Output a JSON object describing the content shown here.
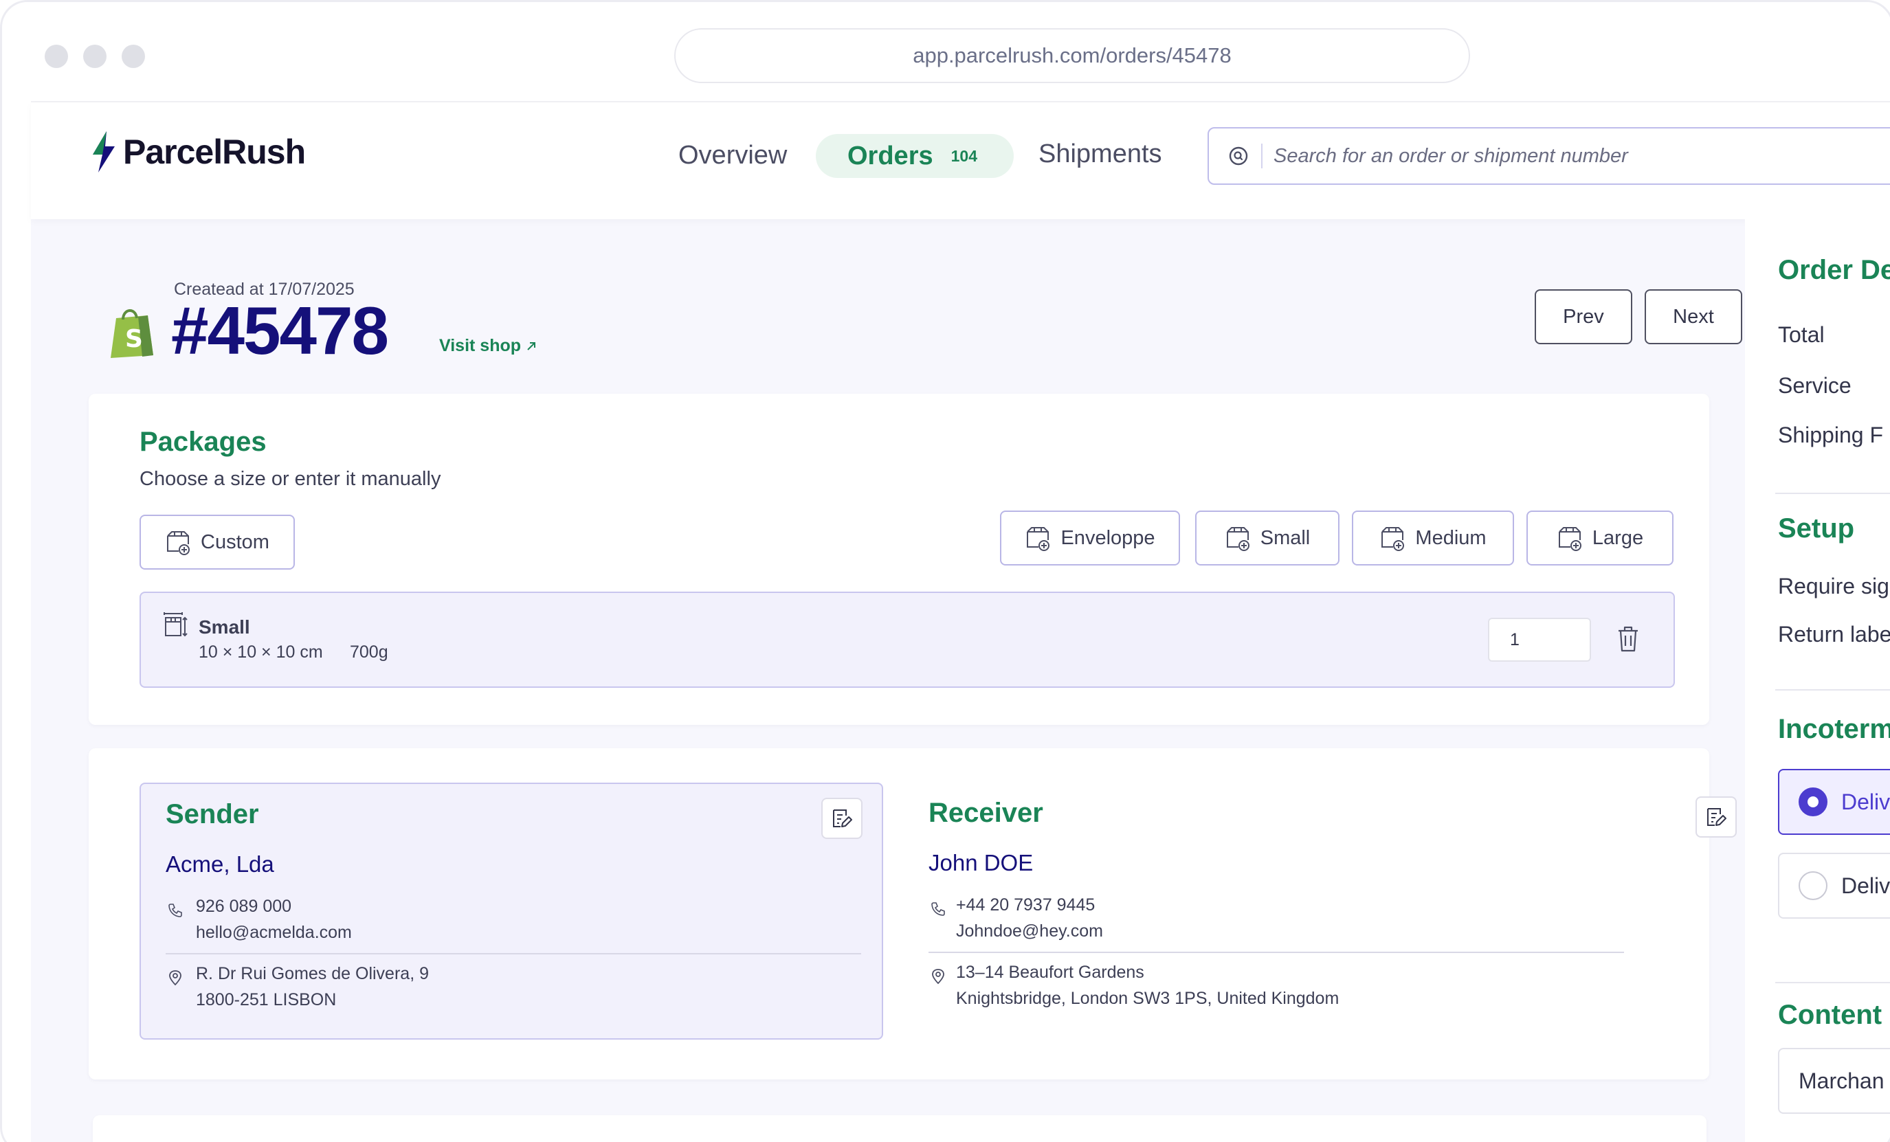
{
  "browser": {
    "url": "app.parcelrush.com/orders/45478"
  },
  "brand": {
    "name": "ParcelRush",
    "accent": "#1a8456",
    "primary": "#15107a",
    "highlight": "#4c3ccf"
  },
  "nav": {
    "overview": "Overview",
    "orders": "Orders",
    "orders_count": "104",
    "shipments": "Shipments",
    "search_placeholder": "Search for an order or shipment number"
  },
  "order": {
    "created": "Createad at 17/07/2025",
    "id": "#45478",
    "visit_shop": "Visit shop",
    "prev": "Prev",
    "next": "Next"
  },
  "packages": {
    "title": "Packages",
    "subtitle": "Choose a size or enter it manually",
    "custom": "Custom",
    "sizes": [
      "Enveloppe",
      "Small",
      "Medium",
      "Large"
    ],
    "items": [
      {
        "name": "Small",
        "dims": "10 × 10 × 10 cm",
        "weight": "700g",
        "qty": "1"
      }
    ]
  },
  "sender": {
    "title": "Sender",
    "name": "Acme, Lda",
    "phone": "926 089 000",
    "email": "hello@acmelda.com",
    "address1": "R. Dr Rui Gomes de Olivera, 9",
    "address2": "1800-251 LISBON"
  },
  "receiver": {
    "title": "Receiver",
    "name": "John DOE",
    "phone": "+44 20 7937 9445",
    "email": "Johndoe@hey.com",
    "address1": "13–14 Beaufort Gardens",
    "address2": "Knightsbridge, London SW3 1PS, United Kingdom"
  },
  "sidebar": {
    "order_details_title": "Order De",
    "total": "Total",
    "service": "Service",
    "shipping": "Shipping F",
    "setup_title": "Setup",
    "require_sig": "Require sig",
    "return_label": "Return labe",
    "incoterms_title": "Incoterm",
    "incoterm_option_1": "Deliv",
    "incoterm_option_2": "Deliv",
    "contents_title": "Content",
    "contents_value": "Marchan"
  }
}
